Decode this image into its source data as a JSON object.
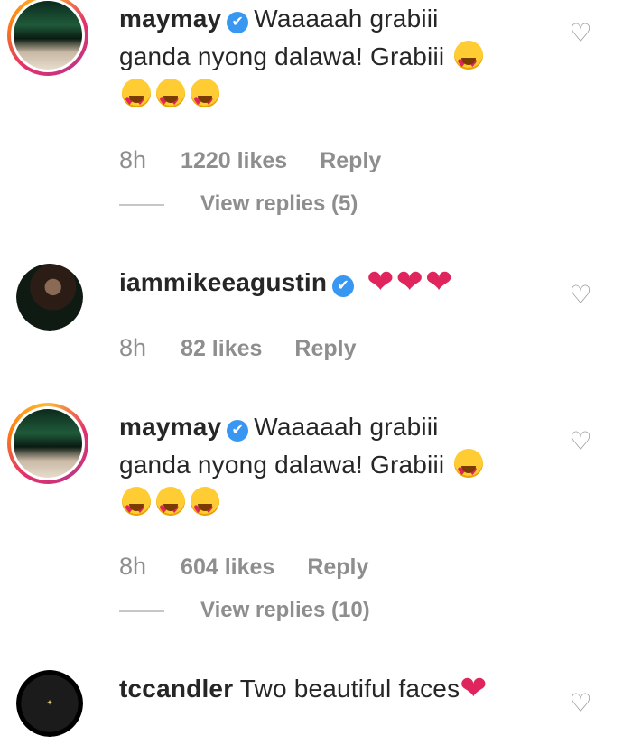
{
  "comments": [
    {
      "username": "maymay",
      "verified": true,
      "text_line1": "Waaaaah grabiii",
      "text_line2": "ganda nyong dalawa! Grabiii",
      "time": "8h",
      "likes": "1220 likes",
      "reply": "Reply",
      "view_replies": "View replies (5)",
      "like_icon": "heart-outline-icon"
    },
    {
      "username": "iammikeeagustin",
      "verified": true,
      "time": "8h",
      "likes": "82 likes",
      "reply": "Reply",
      "like_icon": "heart-outline-icon"
    },
    {
      "username": "maymay",
      "verified": true,
      "text_line1": "Waaaaah grabiii",
      "text_line2": "ganda nyong dalawa! Grabiii",
      "time": "8h",
      "likes": "604 likes",
      "reply": "Reply",
      "view_replies": "View replies (10)",
      "like_icon": "heart-outline-icon"
    },
    {
      "username": "tccandler",
      "verified": false,
      "text": "Two beautiful faces",
      "like_icon": "heart-outline-icon"
    }
  ],
  "icons": {
    "verified": "✔",
    "heart_outline": "♡",
    "heart_emoji": "❤"
  },
  "colors": {
    "text": "#262626",
    "muted": "#8e8e8e",
    "verified_blue": "#3897f0",
    "heart_red": "#e0245e"
  }
}
